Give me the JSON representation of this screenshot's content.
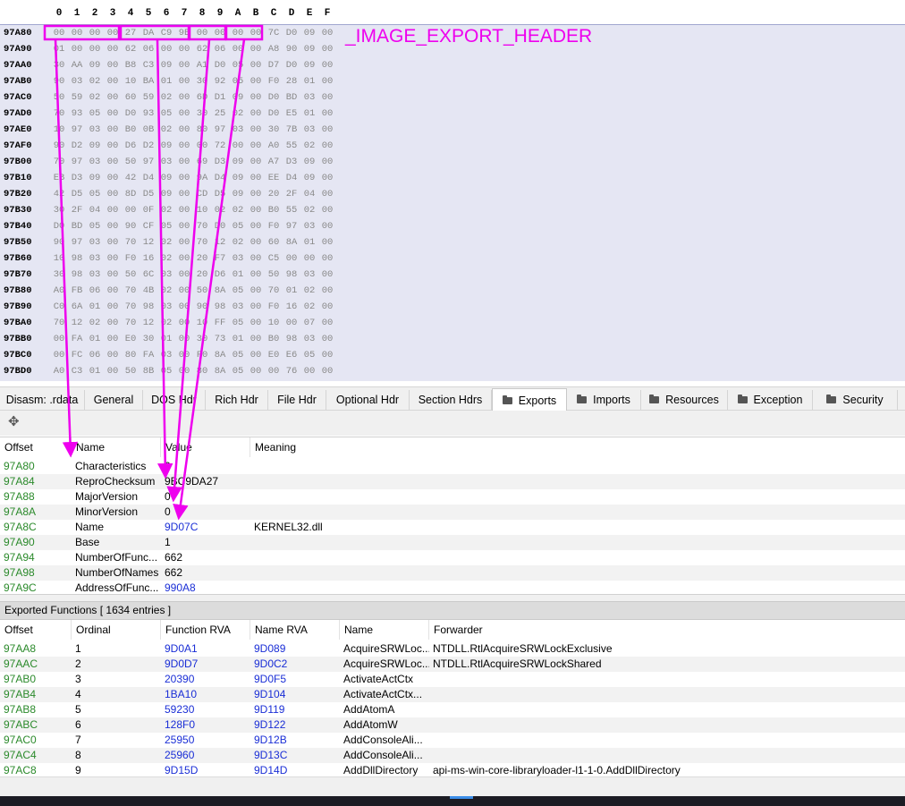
{
  "hex": {
    "columns": [
      "0",
      "1",
      "2",
      "3",
      "4",
      "5",
      "6",
      "7",
      "8",
      "9",
      "A",
      "B",
      "C",
      "D",
      "E",
      "F"
    ],
    "rows": [
      {
        "addr": "97A80",
        "bytes": "00 00 00 00 27 DA C9 9B 00 00 00 00 7C D0 09 00"
      },
      {
        "addr": "97A90",
        "bytes": "01 00 00 00 62 06 00 00 62 06 00 00 A8 90 09 00"
      },
      {
        "addr": "97AA0",
        "bytes": "30 AA 09 00 B8 C3 09 00 A1 D0 05 00 D7 D0 09 00"
      },
      {
        "addr": "97AB0",
        "bytes": "90 03 02 00 10 BA 01 00 30 92 05 00 F0 28 01 00"
      },
      {
        "addr": "97AC0",
        "bytes": "50 59 02 00 60 59 02 00 6D D1 09 00 D0 BD 03 00"
      },
      {
        "addr": "97AD0",
        "bytes": "70 93 05 00 D0 93 05 00 30 25 02 00 D0 E5 01 00"
      },
      {
        "addr": "97AE0",
        "bytes": "10 97 03 00 B0 0B 02 00 80 97 03 00 30 7B 03 00"
      },
      {
        "addr": "97AF0",
        "bytes": "90 D2 09 00 D6 D2 09 00 00 72 00 00 A0 55 02 00"
      },
      {
        "addr": "97B00",
        "bytes": "70 97 03 00 50 97 03 00 69 D3 09 00 A7 D3 09 00"
      },
      {
        "addr": "97B10",
        "bytes": "EB D3 09 00 42 D4 09 00 9A D4 09 00 EE D4 09 00"
      },
      {
        "addr": "97B20",
        "bytes": "42 D5 05 00 8D D5 09 00 CD D5 09 00 20 2F 04 00"
      },
      {
        "addr": "97B30",
        "bytes": "30 2F 04 00 00 0F 02 00 10 02 02 00 B0 55 02 00"
      },
      {
        "addr": "97B40",
        "bytes": "D0 BD 05 00 90 CF 05 00 70 D0 05 00 F0 97 03 00"
      },
      {
        "addr": "97B50",
        "bytes": "90 97 03 00 70 12 02 00 70 12 02 00 60 8A 01 00"
      },
      {
        "addr": "97B60",
        "bytes": "10 98 03 00 F0 16 02 00 20 F7 03 00 C5 00 00 00"
      },
      {
        "addr": "97B70",
        "bytes": "30 98 03 00 50 6C 03 00 20 D6 01 00 50 98 03 00"
      },
      {
        "addr": "97B80",
        "bytes": "A0 FB 06 00 70 4B 02 00 50 8A 05 00 70 01 02 00"
      },
      {
        "addr": "97B90",
        "bytes": "C0 6A 01 00 70 98 03 00 90 98 03 00 F0 16 02 00"
      },
      {
        "addr": "97BA0",
        "bytes": "70 12 02 00 70 12 02 00 10 FF 05 00 10 00 07 00"
      },
      {
        "addr": "97BB0",
        "bytes": "00 FA 01 00 E0 30 01 00 30 73 01 00 B0 98 03 00"
      },
      {
        "addr": "97BC0",
        "bytes": "00 FC 06 00 80 FA 03 00 F0 8A 05 00 E0 E6 05 00"
      },
      {
        "addr": "97BD0",
        "bytes": "A0 C3 01 00 50 8B 05 00 80 8A 05 00 00 76 00 00"
      }
    ],
    "annotation": "_IMAGE_EXPORT_HEADER"
  },
  "tabs": [
    {
      "label": "Disasm: .rdata",
      "folder": false,
      "active": false
    },
    {
      "label": "General",
      "folder": false,
      "active": false
    },
    {
      "label": "DOS Hdr",
      "folder": false,
      "active": false
    },
    {
      "label": "Rich Hdr",
      "folder": false,
      "active": false
    },
    {
      "label": "File Hdr",
      "folder": false,
      "active": false
    },
    {
      "label": "Optional Hdr",
      "folder": false,
      "active": false
    },
    {
      "label": "Section Hdrs",
      "folder": false,
      "active": false
    },
    {
      "label": "Exports",
      "folder": true,
      "active": true
    },
    {
      "label": "Imports",
      "folder": true,
      "active": false
    },
    {
      "label": "Resources",
      "folder": true,
      "active": false
    },
    {
      "label": "Exception",
      "folder": true,
      "active": false
    },
    {
      "label": "Security",
      "folder": true,
      "active": false
    }
  ],
  "header_table": {
    "columns": [
      "Offset",
      "Name",
      "Value",
      "Meaning"
    ],
    "rows": [
      {
        "offset": "97A80",
        "name": "Characteristics",
        "value": "0",
        "meaning": "",
        "link": false
      },
      {
        "offset": "97A84",
        "name": "ReproChecksum",
        "value": "9BC9DA27",
        "meaning": "",
        "link": false
      },
      {
        "offset": "97A88",
        "name": "MajorVersion",
        "value": "0",
        "meaning": "",
        "link": false
      },
      {
        "offset": "97A8A",
        "name": "MinorVersion",
        "value": "0",
        "meaning": "",
        "link": false
      },
      {
        "offset": "97A8C",
        "name": "Name",
        "value": "9D07C",
        "meaning": "KERNEL32.dll",
        "link": true
      },
      {
        "offset": "97A90",
        "name": "Base",
        "value": "1",
        "meaning": "",
        "link": false
      },
      {
        "offset": "97A94",
        "name": "NumberOfFunc...",
        "value": "662",
        "meaning": "",
        "link": false
      },
      {
        "offset": "97A98",
        "name": "NumberOfNames",
        "value": "662",
        "meaning": "",
        "link": false
      },
      {
        "offset": "97A9C",
        "name": "AddressOfFunc...",
        "value": "990A8",
        "meaning": "",
        "link": true
      }
    ]
  },
  "exports": {
    "title": "Exported Functions   [ 1634 entries ]",
    "columns": [
      "Offset",
      "Ordinal",
      "Function RVA",
      "Name RVA",
      "Name",
      "Forwarder"
    ],
    "rows": [
      {
        "offset": "97AA8",
        "ordinal": "1",
        "func_rva": "9D0A1",
        "name_rva": "9D089",
        "name": "AcquireSRWLoc...",
        "forwarder": "NTDLL.RtlAcquireSRWLockExclusive"
      },
      {
        "offset": "97AAC",
        "ordinal": "2",
        "func_rva": "9D0D7",
        "name_rva": "9D0C2",
        "name": "AcquireSRWLoc...",
        "forwarder": "NTDLL.RtlAcquireSRWLockShared"
      },
      {
        "offset": "97AB0",
        "ordinal": "3",
        "func_rva": "20390",
        "name_rva": "9D0F5",
        "name": "ActivateActCtx",
        "forwarder": ""
      },
      {
        "offset": "97AB4",
        "ordinal": "4",
        "func_rva": "1BA10",
        "name_rva": "9D104",
        "name": "ActivateActCtx...",
        "forwarder": ""
      },
      {
        "offset": "97AB8",
        "ordinal": "5",
        "func_rva": "59230",
        "name_rva": "9D119",
        "name": "AddAtomA",
        "forwarder": ""
      },
      {
        "offset": "97ABC",
        "ordinal": "6",
        "func_rva": "128F0",
        "name_rva": "9D122",
        "name": "AddAtomW",
        "forwarder": ""
      },
      {
        "offset": "97AC0",
        "ordinal": "7",
        "func_rva": "25950",
        "name_rva": "9D12B",
        "name": "AddConsoleAli...",
        "forwarder": ""
      },
      {
        "offset": "97AC4",
        "ordinal": "8",
        "func_rva": "25960",
        "name_rva": "9D13C",
        "name": "AddConsoleAli...",
        "forwarder": ""
      },
      {
        "offset": "97AC8",
        "ordinal": "9",
        "func_rva": "9D15D",
        "name_rva": "9D14D",
        "name": "AddDllDirectory",
        "forwarder": "api-ms-win-core-libraryloader-l1-1-0.AddDllDirectory"
      }
    ]
  },
  "colors": {
    "annotation": "#ee00ee",
    "offset": "#2b8a2b",
    "link": "#1a2ed6",
    "hex_bg": "#e5e6f3"
  },
  "icons": {
    "toolbar": "move-icon",
    "tab": "folder-icon"
  }
}
